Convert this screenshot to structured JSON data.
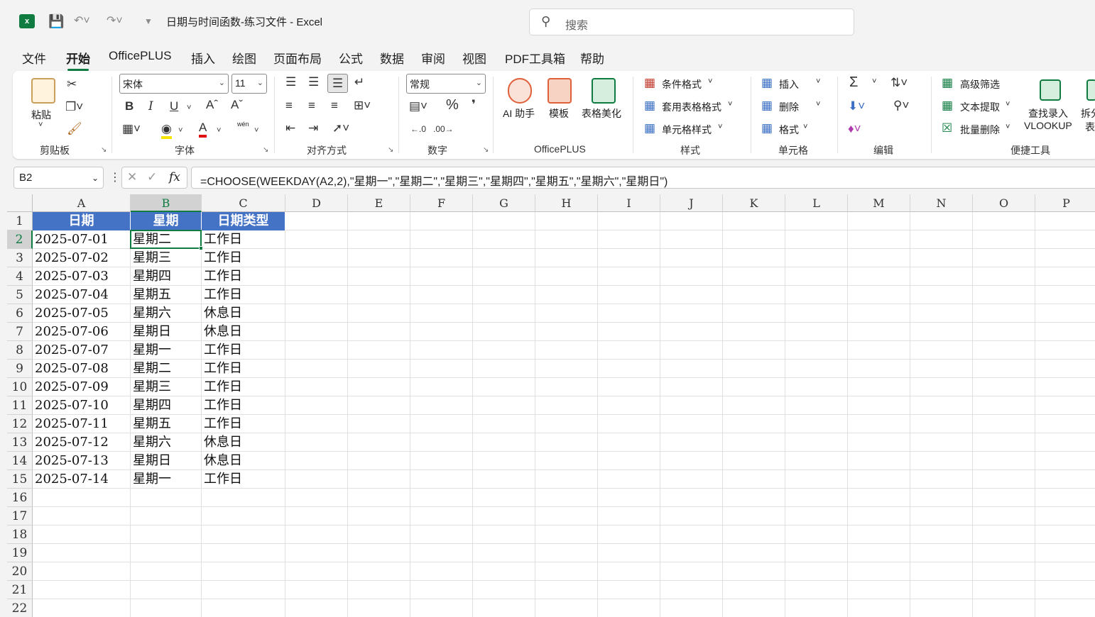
{
  "app": {
    "logo_letter": "x",
    "doc_title": "日期与时间函数-练习文件  -  Excel"
  },
  "search": {
    "placeholder": "搜索"
  },
  "tabs": [
    "文件",
    "开始",
    "OfficePLUS",
    "插入",
    "绘图",
    "页面布局",
    "公式",
    "数据",
    "审阅",
    "视图",
    "PDF工具箱",
    "帮助"
  ],
  "active_tab": "开始",
  "ribbon": {
    "clipboard": {
      "label": "剪贴板",
      "paste": "粘贴"
    },
    "font": {
      "label": "字体",
      "font_name": "宋体",
      "font_size": "11",
      "bold": "B",
      "italic": "I",
      "underline": "U",
      "wen": "wén"
    },
    "align": {
      "label": "对齐方式"
    },
    "number": {
      "label": "数字",
      "format": "常规",
      "percent": "%"
    },
    "officeplus": {
      "label": "OfficePLUS",
      "ai": "AI 助手",
      "template": "模板",
      "beautify": "表格美化"
    },
    "styles": {
      "label": "样式",
      "cond": "条件格式",
      "table": "套用表格格式",
      "cell": "单元格样式"
    },
    "cells": {
      "label": "单元格",
      "insert": "插入",
      "delete": "删除",
      "format": "格式"
    },
    "editing": {
      "label": "编辑",
      "sum": "Σ"
    },
    "quick": {
      "label": "便捷工具",
      "filter": "高级筛选",
      "extract": "文本提取",
      "batch_delete": "批量删除",
      "lookup1": "查找录入",
      "lookup2": "VLOOKUP",
      "split1": "拆分",
      "split2": "表"
    }
  },
  "formula_bar": {
    "name_box": "B2",
    "fx": "fx",
    "formula": "=CHOOSE(WEEKDAY(A2,2),\"星期一\",\"星期二\",\"星期三\",\"星期四\",\"星期五\",\"星期六\",\"星期日\")"
  },
  "grid": {
    "columns": [
      "A",
      "B",
      "C",
      "D",
      "E",
      "F",
      "G",
      "H",
      "I",
      "J",
      "K",
      "L",
      "M",
      "N",
      "O",
      "P"
    ],
    "rows": [
      "1",
      "2",
      "3",
      "4",
      "5",
      "6",
      "7",
      "8",
      "9",
      "10",
      "11",
      "12",
      "13",
      "14",
      "15",
      "16",
      "17",
      "18",
      "19",
      "20",
      "21",
      "22"
    ],
    "selected_cell": "B2",
    "header": [
      "日期",
      "星期",
      "日期类型"
    ],
    "data": [
      [
        "2025-07-01",
        "星期二",
        "工作日"
      ],
      [
        "2025-07-02",
        "星期三",
        "工作日"
      ],
      [
        "2025-07-03",
        "星期四",
        "工作日"
      ],
      [
        "2025-07-04",
        "星期五",
        "工作日"
      ],
      [
        "2025-07-05",
        "星期六",
        "休息日"
      ],
      [
        "2025-07-06",
        "星期日",
        "休息日"
      ],
      [
        "2025-07-07",
        "星期一",
        "工作日"
      ],
      [
        "2025-07-08",
        "星期二",
        "工作日"
      ],
      [
        "2025-07-09",
        "星期三",
        "工作日"
      ],
      [
        "2025-07-10",
        "星期四",
        "工作日"
      ],
      [
        "2025-07-11",
        "星期五",
        "工作日"
      ],
      [
        "2025-07-12",
        "星期六",
        "休息日"
      ],
      [
        "2025-07-13",
        "星期日",
        "休息日"
      ],
      [
        "2025-07-14",
        "星期一",
        "工作日"
      ]
    ]
  },
  "colors": {
    "accent": "#107c41",
    "header_fill": "#4472c4"
  }
}
